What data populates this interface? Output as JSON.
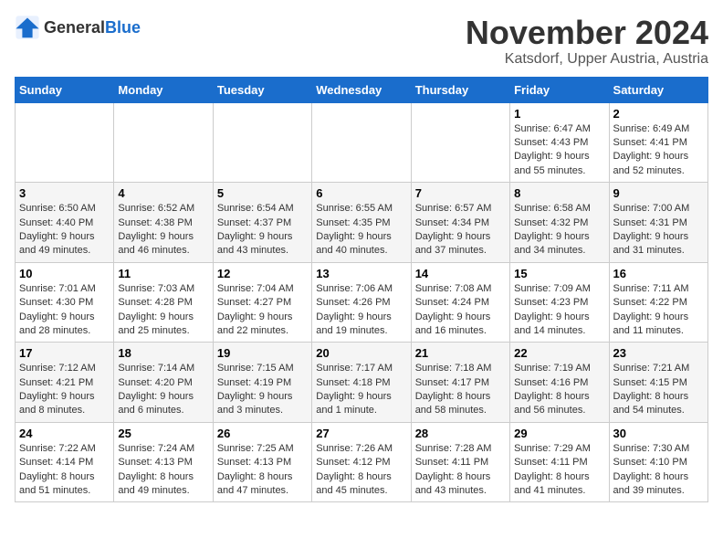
{
  "header": {
    "logo_general": "General",
    "logo_blue": "Blue",
    "month_title": "November 2024",
    "location": "Katsdorf, Upper Austria, Austria"
  },
  "days_of_week": [
    "Sunday",
    "Monday",
    "Tuesday",
    "Wednesday",
    "Thursday",
    "Friday",
    "Saturday"
  ],
  "weeks": [
    [
      {
        "day": "",
        "info": ""
      },
      {
        "day": "",
        "info": ""
      },
      {
        "day": "",
        "info": ""
      },
      {
        "day": "",
        "info": ""
      },
      {
        "day": "",
        "info": ""
      },
      {
        "day": "1",
        "info": "Sunrise: 6:47 AM\nSunset: 4:43 PM\nDaylight: 9 hours and 55 minutes."
      },
      {
        "day": "2",
        "info": "Sunrise: 6:49 AM\nSunset: 4:41 PM\nDaylight: 9 hours and 52 minutes."
      }
    ],
    [
      {
        "day": "3",
        "info": "Sunrise: 6:50 AM\nSunset: 4:40 PM\nDaylight: 9 hours and 49 minutes."
      },
      {
        "day": "4",
        "info": "Sunrise: 6:52 AM\nSunset: 4:38 PM\nDaylight: 9 hours and 46 minutes."
      },
      {
        "day": "5",
        "info": "Sunrise: 6:54 AM\nSunset: 4:37 PM\nDaylight: 9 hours and 43 minutes."
      },
      {
        "day": "6",
        "info": "Sunrise: 6:55 AM\nSunset: 4:35 PM\nDaylight: 9 hours and 40 minutes."
      },
      {
        "day": "7",
        "info": "Sunrise: 6:57 AM\nSunset: 4:34 PM\nDaylight: 9 hours and 37 minutes."
      },
      {
        "day": "8",
        "info": "Sunrise: 6:58 AM\nSunset: 4:32 PM\nDaylight: 9 hours and 34 minutes."
      },
      {
        "day": "9",
        "info": "Sunrise: 7:00 AM\nSunset: 4:31 PM\nDaylight: 9 hours and 31 minutes."
      }
    ],
    [
      {
        "day": "10",
        "info": "Sunrise: 7:01 AM\nSunset: 4:30 PM\nDaylight: 9 hours and 28 minutes."
      },
      {
        "day": "11",
        "info": "Sunrise: 7:03 AM\nSunset: 4:28 PM\nDaylight: 9 hours and 25 minutes."
      },
      {
        "day": "12",
        "info": "Sunrise: 7:04 AM\nSunset: 4:27 PM\nDaylight: 9 hours and 22 minutes."
      },
      {
        "day": "13",
        "info": "Sunrise: 7:06 AM\nSunset: 4:26 PM\nDaylight: 9 hours and 19 minutes."
      },
      {
        "day": "14",
        "info": "Sunrise: 7:08 AM\nSunset: 4:24 PM\nDaylight: 9 hours and 16 minutes."
      },
      {
        "day": "15",
        "info": "Sunrise: 7:09 AM\nSunset: 4:23 PM\nDaylight: 9 hours and 14 minutes."
      },
      {
        "day": "16",
        "info": "Sunrise: 7:11 AM\nSunset: 4:22 PM\nDaylight: 9 hours and 11 minutes."
      }
    ],
    [
      {
        "day": "17",
        "info": "Sunrise: 7:12 AM\nSunset: 4:21 PM\nDaylight: 9 hours and 8 minutes."
      },
      {
        "day": "18",
        "info": "Sunrise: 7:14 AM\nSunset: 4:20 PM\nDaylight: 9 hours and 6 minutes."
      },
      {
        "day": "19",
        "info": "Sunrise: 7:15 AM\nSunset: 4:19 PM\nDaylight: 9 hours and 3 minutes."
      },
      {
        "day": "20",
        "info": "Sunrise: 7:17 AM\nSunset: 4:18 PM\nDaylight: 9 hours and 1 minute."
      },
      {
        "day": "21",
        "info": "Sunrise: 7:18 AM\nSunset: 4:17 PM\nDaylight: 8 hours and 58 minutes."
      },
      {
        "day": "22",
        "info": "Sunrise: 7:19 AM\nSunset: 4:16 PM\nDaylight: 8 hours and 56 minutes."
      },
      {
        "day": "23",
        "info": "Sunrise: 7:21 AM\nSunset: 4:15 PM\nDaylight: 8 hours and 54 minutes."
      }
    ],
    [
      {
        "day": "24",
        "info": "Sunrise: 7:22 AM\nSunset: 4:14 PM\nDaylight: 8 hours and 51 minutes."
      },
      {
        "day": "25",
        "info": "Sunrise: 7:24 AM\nSunset: 4:13 PM\nDaylight: 8 hours and 49 minutes."
      },
      {
        "day": "26",
        "info": "Sunrise: 7:25 AM\nSunset: 4:13 PM\nDaylight: 8 hours and 47 minutes."
      },
      {
        "day": "27",
        "info": "Sunrise: 7:26 AM\nSunset: 4:12 PM\nDaylight: 8 hours and 45 minutes."
      },
      {
        "day": "28",
        "info": "Sunrise: 7:28 AM\nSunset: 4:11 PM\nDaylight: 8 hours and 43 minutes."
      },
      {
        "day": "29",
        "info": "Sunrise: 7:29 AM\nSunset: 4:11 PM\nDaylight: 8 hours and 41 minutes."
      },
      {
        "day": "30",
        "info": "Sunrise: 7:30 AM\nSunset: 4:10 PM\nDaylight: 8 hours and 39 minutes."
      }
    ]
  ]
}
